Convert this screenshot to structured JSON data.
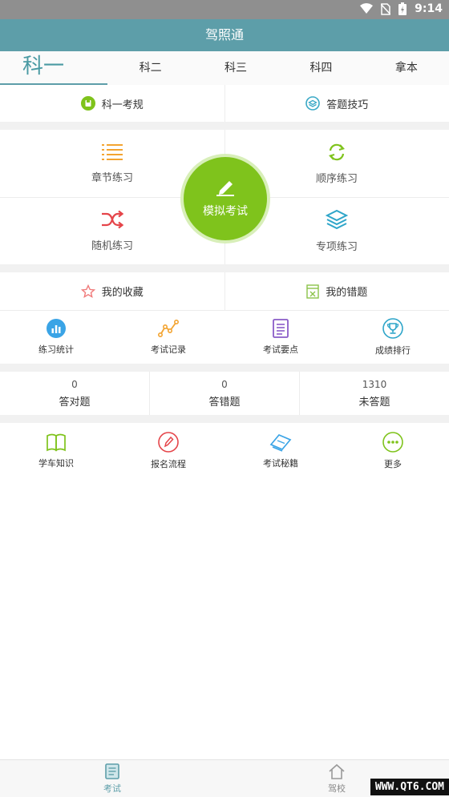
{
  "status": {
    "time": "9:14"
  },
  "app": {
    "title": "驾照通"
  },
  "tabs": [
    "科一",
    "科二",
    "科三",
    "科四",
    "拿本"
  ],
  "quick": {
    "rules": "科一考规",
    "tips": "答题技巧"
  },
  "practice": {
    "chapter": "章节练习",
    "sequence": "顺序练习",
    "random": "随机练习",
    "special": "专项练习",
    "mock": "模拟考试"
  },
  "fav": {
    "collect": "我的收藏",
    "wrong": "我的错题"
  },
  "tools": [
    "练习统计",
    "考试记录",
    "考试要点",
    "成绩排行"
  ],
  "stats": [
    {
      "value": "0",
      "label": "答对题"
    },
    {
      "value": "0",
      "label": "答错题"
    },
    {
      "value": "1310",
      "label": "未答题"
    }
  ],
  "more": [
    "学车知识",
    "报名流程",
    "考试秘籍",
    "更多"
  ],
  "bottom": {
    "exam": "考试",
    "school": "驾校"
  },
  "watermark": "WWW.QT6.COM",
  "colors": {
    "titlebar": "#5d9ea9",
    "mock_button": "#7fc31c"
  }
}
